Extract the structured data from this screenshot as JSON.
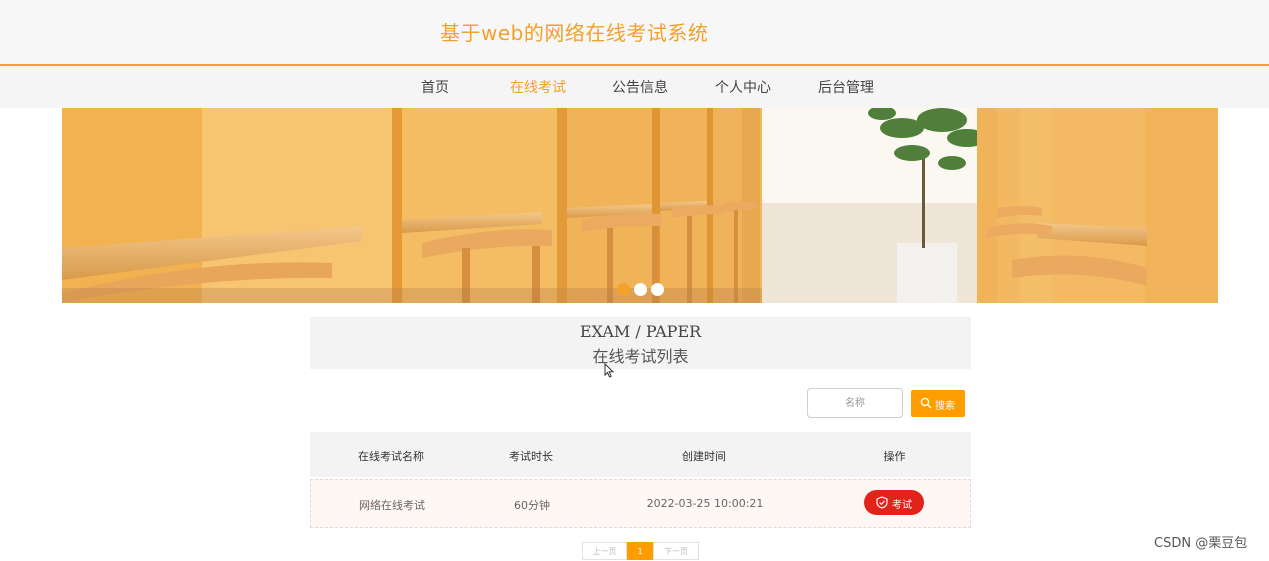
{
  "header": {
    "site_title": "基于web的网络在线考试系统"
  },
  "nav": {
    "items": [
      {
        "label": "首页"
      },
      {
        "label": "在线考试",
        "active": true
      },
      {
        "label": "公告信息"
      },
      {
        "label": "个人中心"
      },
      {
        "label": "后台管理"
      }
    ]
  },
  "carousel": {
    "slide_count": 3,
    "active_index": 0
  },
  "section": {
    "title_en": "EXAM / PAPER",
    "title_cn": "在线考试列表"
  },
  "search": {
    "placeholder": "名称",
    "button_label": "搜索",
    "icon": "search-icon"
  },
  "table": {
    "columns": [
      "在线考试名称",
      "考试时长",
      "创建时间",
      "操作"
    ],
    "rows": [
      {
        "name": "网络在线考试",
        "duration": "60分钟",
        "created": "2022-03-25 10:00:21",
        "action_label": "考试",
        "action_icon": "shield-check-icon"
      }
    ]
  },
  "pagination": {
    "prev_label": "上一页",
    "current_page": "1",
    "next_label": "下一页"
  },
  "watermark": "CSDN @栗豆包",
  "colors": {
    "accent": "#f2a12b",
    "search_button": "#ff9d00",
    "exam_button": "#e2231a"
  }
}
